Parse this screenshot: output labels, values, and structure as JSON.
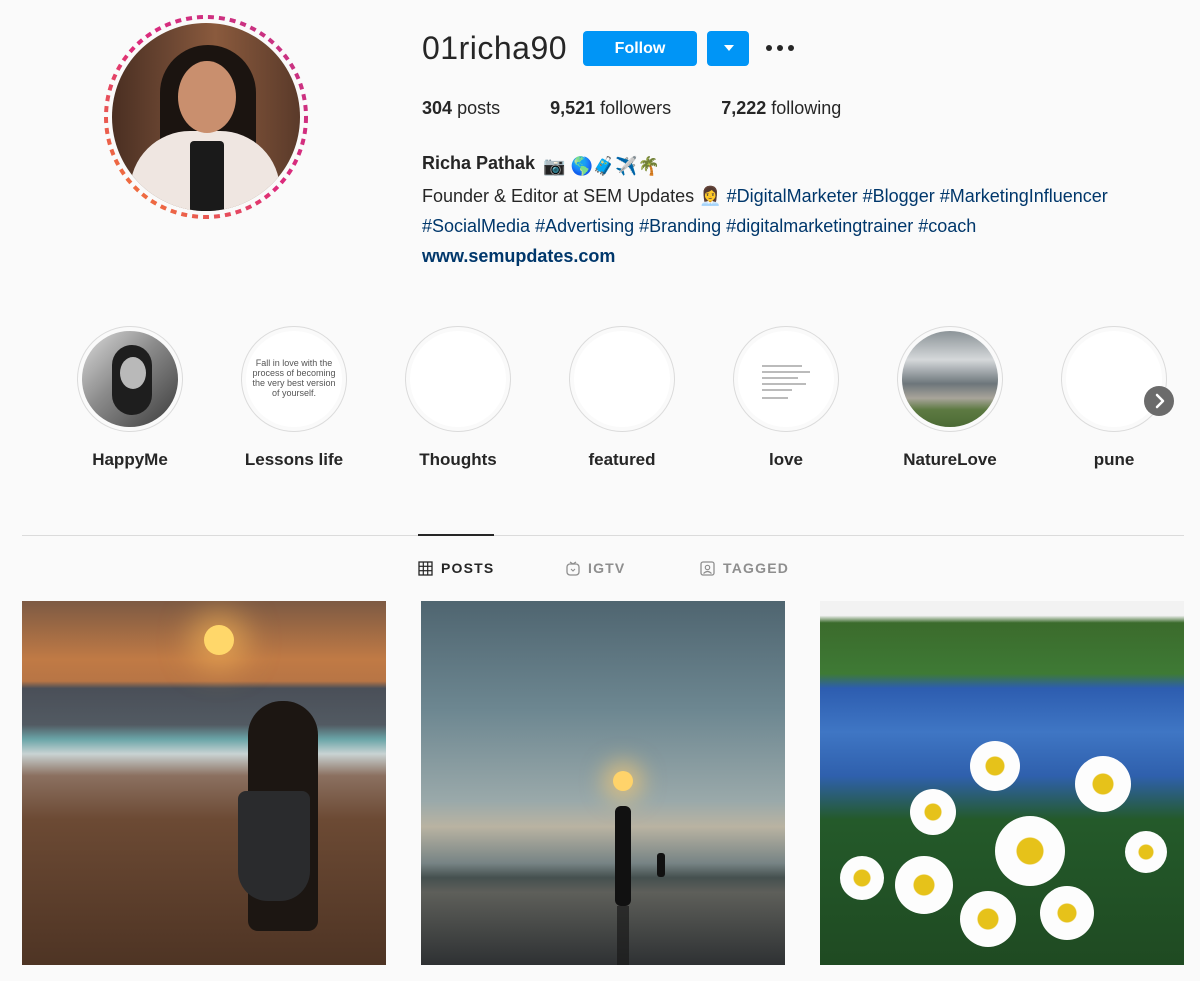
{
  "profile": {
    "username": "01richa90",
    "follow_label": "Follow",
    "stats": [
      {
        "value": "304",
        "label": "posts"
      },
      {
        "value": "9,521",
        "label": "followers"
      },
      {
        "value": "7,222",
        "label": "following"
      }
    ],
    "name": "Richa Pathak",
    "name_emojis": "📷 🌎🧳✈️🌴",
    "bio_line1": "Founder & Editor at SEM Updates",
    "bio_emoji": "👩‍💼",
    "hashtags_line1": "#DigitalMarketer #Blogger #MarketingInfluencer",
    "hashtags_line2": "#SocialMedia #Advertising #Branding #digitalmarketingtrainer #coach",
    "website": "www.semupdates.com"
  },
  "highlights": [
    {
      "label": "HappyMe"
    },
    {
      "label": "Lessons life",
      "quote": "Fall in love with the process of becoming the very best version of yourself."
    },
    {
      "label": "Thoughts"
    },
    {
      "label": "featured"
    },
    {
      "label": "love"
    },
    {
      "label": "NatureLove"
    },
    {
      "label": "pune"
    }
  ],
  "tabs": [
    {
      "label": "POSTS",
      "icon": "grid-icon",
      "active": true
    },
    {
      "label": "IGTV",
      "icon": "igtv-icon",
      "active": false
    },
    {
      "label": "TAGGED",
      "icon": "tagged-icon",
      "active": false
    }
  ],
  "colors": {
    "primary_button": "#0095f6",
    "link": "#00376b",
    "story_ring_start": "#f58529",
    "story_ring_end": "#c13584"
  }
}
